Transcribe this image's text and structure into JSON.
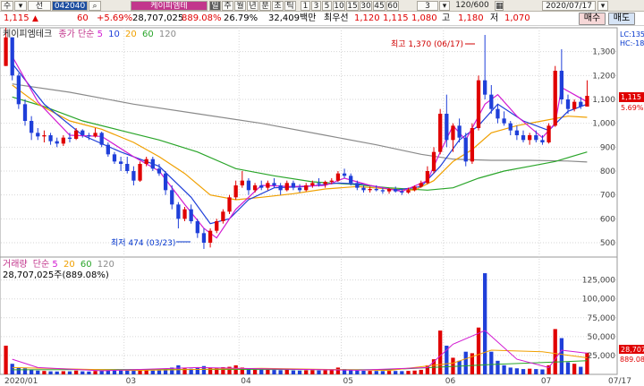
{
  "toolbar": {
    "cells": [
      "수",
      "선",
      "042040",
      "케이피엠테",
      "일",
      "주",
      "월",
      "년",
      "분",
      "초",
      "틱",
      "1",
      "3",
      "5",
      "10",
      "15",
      "30",
      "45",
      "60",
      "3",
      "120/600",
      "2020/07/17"
    ]
  },
  "info": {
    "price": "1,115",
    "arrow": "▲",
    "change": "60",
    "change_pct": "+5.69%",
    "volume": "28,707,025",
    "volume_ratio": "889.08%",
    "turnover": "26.79%",
    "amount": "32,409백만",
    "best_ask_label": "최우선",
    "best_ask": "1,120",
    "best_bid": "1,115",
    "low_val": "1,080",
    "high_label": "고",
    "high_val": "1,180",
    "low_label": "저",
    "low2_val": "1,070",
    "buy_label": "매수",
    "sell_label": "매도"
  },
  "price_legend": {
    "name": "케이피엠테크",
    "ma_label": "종가 단순",
    "ma_periods": [
      "5",
      "10",
      "20",
      "60",
      "120"
    ],
    "ma_colors": [
      "#d21bd2",
      "#1f3fd9",
      "#f0a000",
      "#2aa52a",
      "#8a8a8a"
    ]
  },
  "vol_legend": {
    "name": "거래량",
    "ma_label": "단순",
    "ma_periods": [
      "5",
      "20",
      "60",
      "120"
    ],
    "ma_colors": [
      "#d21bd2",
      "#f0a000",
      "#2aa52a",
      "#8a8a8a"
    ],
    "summary": "28,707,025주(889.08%)"
  },
  "price_axis": {
    "ticks": [
      "1,300",
      "1,200",
      "1,100",
      "1,000",
      "900",
      "800",
      "700",
      "600",
      "500"
    ],
    "current_label": "1,115",
    "pct_label": "5.69%",
    "lc_label": "LC:135",
    "hc_label": "HC:-18"
  },
  "volume_axis": {
    "ticks": [
      "125,000",
      "100,000",
      "75,000",
      "50,000",
      "25,000"
    ],
    "current_label": "28,707",
    "pct_label": "889.08"
  },
  "x_axis": {
    "ticks": [
      "2020/01",
      "03",
      "04",
      "05",
      "06",
      "07",
      "07/17"
    ]
  },
  "annotations": {
    "high": "최고 1,370 (06/17)",
    "low": "최저 474 (03/23)"
  },
  "colors": {
    "up": "#e00000",
    "down": "#1f3fd9",
    "ma5": "#d21bd2",
    "ma10": "#1f3fd9",
    "ma20": "#f0a000",
    "ma60": "#2aa52a",
    "ma120": "#8a8a8a"
  },
  "chart_data": {
    "type": "candlestick",
    "x_start": "2020/01",
    "x_end": "07/17",
    "ylim": [
      440,
      1400
    ],
    "volume_ylim": [
      0,
      140000
    ],
    "candles": [
      [
        1240,
        1400,
        1240,
        1360
      ],
      [
        1360,
        1360,
        1180,
        1200
      ],
      [
        1200,
        1210,
        1060,
        1080
      ],
      [
        1080,
        1100,
        990,
        1010
      ],
      [
        1010,
        1030,
        930,
        960
      ],
      [
        960,
        980,
        930,
        945
      ],
      [
        945,
        970,
        920,
        950
      ],
      [
        950,
        960,
        910,
        925
      ],
      [
        925,
        940,
        900,
        915
      ],
      [
        915,
        950,
        905,
        940
      ],
      [
        940,
        960,
        920,
        935
      ],
      [
        935,
        980,
        930,
        970
      ],
      [
        970,
        975,
        940,
        950
      ],
      [
        950,
        960,
        930,
        945
      ],
      [
        945,
        980,
        940,
        960
      ],
      [
        960,
        965,
        900,
        910
      ],
      [
        910,
        920,
        860,
        870
      ],
      [
        870,
        880,
        830,
        840
      ],
      [
        840,
        860,
        800,
        830
      ],
      [
        830,
        860,
        790,
        800
      ],
      [
        800,
        820,
        740,
        760
      ],
      [
        760,
        840,
        755,
        830
      ],
      [
        830,
        860,
        820,
        850
      ],
      [
        850,
        860,
        800,
        810
      ],
      [
        810,
        830,
        780,
        790
      ],
      [
        790,
        800,
        700,
        720
      ],
      [
        720,
        740,
        640,
        660
      ],
      [
        660,
        670,
        560,
        600
      ],
      [
        600,
        650,
        590,
        640
      ],
      [
        640,
        660,
        580,
        590
      ],
      [
        590,
        600,
        520,
        540
      ],
      [
        540,
        560,
        474,
        500
      ],
      [
        500,
        560,
        480,
        550
      ],
      [
        550,
        600,
        540,
        590
      ],
      [
        590,
        640,
        580,
        630
      ],
      [
        630,
        700,
        620,
        690
      ],
      [
        690,
        760,
        680,
        740
      ],
      [
        740,
        800,
        730,
        760
      ],
      [
        760,
        770,
        700,
        720
      ],
      [
        720,
        750,
        710,
        740
      ],
      [
        740,
        760,
        720,
        730
      ],
      [
        730,
        760,
        720,
        750
      ],
      [
        750,
        770,
        730,
        740
      ],
      [
        740,
        750,
        700,
        720
      ],
      [
        720,
        760,
        715,
        750
      ],
      [
        750,
        760,
        720,
        730
      ],
      [
        730,
        745,
        710,
        720
      ],
      [
        720,
        750,
        715,
        740
      ],
      [
        740,
        760,
        730,
        750
      ],
      [
        750,
        770,
        735,
        745
      ],
      [
        745,
        760,
        730,
        755
      ],
      [
        755,
        770,
        745,
        760
      ],
      [
        760,
        800,
        755,
        790
      ],
      [
        790,
        810,
        770,
        780
      ],
      [
        780,
        790,
        740,
        750
      ],
      [
        750,
        760,
        720,
        730
      ],
      [
        730,
        740,
        710,
        720
      ],
      [
        720,
        735,
        710,
        725
      ],
      [
        725,
        740,
        715,
        720
      ],
      [
        720,
        730,
        705,
        715
      ],
      [
        715,
        730,
        705,
        725
      ],
      [
        725,
        735,
        710,
        715
      ],
      [
        715,
        725,
        700,
        710
      ],
      [
        710,
        730,
        705,
        720
      ],
      [
        720,
        740,
        715,
        735
      ],
      [
        735,
        760,
        730,
        750
      ],
      [
        750,
        820,
        745,
        800
      ],
      [
        800,
        900,
        790,
        880
      ],
      [
        880,
        1060,
        870,
        1040
      ],
      [
        1040,
        1120,
        900,
        930
      ],
      [
        930,
        1000,
        880,
        990
      ],
      [
        990,
        1020,
        920,
        940
      ],
      [
        940,
        960,
        820,
        840
      ],
      [
        840,
        1000,
        830,
        980
      ],
      [
        980,
        1200,
        970,
        1180
      ],
      [
        1180,
        1370,
        1100,
        1120
      ],
      [
        1120,
        1160,
        1040,
        1060
      ],
      [
        1060,
        1080,
        1000,
        1020
      ],
      [
        1020,
        1050,
        990,
        1000
      ],
      [
        1000,
        1010,
        950,
        970
      ],
      [
        970,
        990,
        930,
        950
      ],
      [
        950,
        970,
        920,
        930
      ],
      [
        930,
        960,
        910,
        950
      ],
      [
        950,
        970,
        920,
        930
      ],
      [
        930,
        950,
        910,
        920
      ],
      [
        920,
        1000,
        915,
        990
      ],
      [
        990,
        1240,
        985,
        1220
      ],
      [
        1220,
        1310,
        1080,
        1100
      ],
      [
        1100,
        1120,
        1040,
        1060
      ],
      [
        1060,
        1100,
        1050,
        1090
      ],
      [
        1090,
        1110,
        1060,
        1070
      ],
      [
        1070,
        1180,
        1070,
        1115
      ]
    ],
    "volumes": [
      38000,
      14000,
      9000,
      8000,
      6000,
      5000,
      4500,
      4000,
      3800,
      4200,
      4000,
      5000,
      4000,
      3800,
      4500,
      5500,
      5000,
      4800,
      5200,
      5000,
      6000,
      7000,
      6500,
      5000,
      5200,
      7000,
      9000,
      12000,
      8000,
      7500,
      9000,
      11000,
      9000,
      8500,
      9500,
      10000,
      12000,
      9000,
      7000,
      6500,
      6000,
      6200,
      5800,
      5500,
      6000,
      5200,
      5000,
      5400,
      5600,
      5200,
      5500,
      5800,
      9000,
      7000,
      6000,
      5000,
      4800,
      4600,
      4500,
      4400,
      4600,
      4500,
      4300,
      4600,
      5000,
      6000,
      12000,
      20000,
      58000,
      38000,
      22000,
      18000,
      30000,
      28000,
      62000,
      134000,
      30000,
      18000,
      12000,
      9000,
      8000,
      7000,
      7500,
      7000,
      6500,
      12000,
      60000,
      48000,
      16000,
      14000,
      10000,
      28707
    ],
    "ma_lines": {
      "ma5": [
        [
          1,
          1280
        ],
        [
          5,
          1090
        ],
        [
          10,
          950
        ],
        [
          15,
          945
        ],
        [
          20,
          860
        ],
        [
          24,
          800
        ],
        [
          28,
          660
        ],
        [
          31,
          560
        ],
        [
          33,
          520
        ],
        [
          36,
          640
        ],
        [
          40,
          740
        ],
        [
          45,
          735
        ],
        [
          50,
          740
        ],
        [
          53,
          770
        ],
        [
          57,
          740
        ],
        [
          62,
          715
        ],
        [
          66,
          760
        ],
        [
          68,
          880
        ],
        [
          70,
          990
        ],
        [
          72,
          930
        ],
        [
          75,
          1080
        ],
        [
          77,
          1120
        ],
        [
          80,
          1030
        ],
        [
          84,
          940
        ],
        [
          86,
          1000
        ],
        [
          87,
          1150
        ],
        [
          89,
          1120
        ],
        [
          91,
          1090
        ]
      ],
      "ma10": [
        [
          1,
          1250
        ],
        [
          6,
          1080
        ],
        [
          12,
          950
        ],
        [
          18,
          880
        ],
        [
          24,
          820
        ],
        [
          29,
          690
        ],
        [
          32,
          580
        ],
        [
          35,
          600
        ],
        [
          38,
          680
        ],
        [
          42,
          730
        ],
        [
          47,
          735
        ],
        [
          52,
          750
        ],
        [
          56,
          745
        ],
        [
          61,
          720
        ],
        [
          65,
          735
        ],
        [
          68,
          820
        ],
        [
          71,
          930
        ],
        [
          74,
          990
        ],
        [
          77,
          1080
        ],
        [
          81,
          1010
        ],
        [
          85,
          970
        ],
        [
          88,
          1050
        ],
        [
          91,
          1080
        ]
      ],
      "ma20": [
        [
          1,
          1160
        ],
        [
          5,
          1080
        ],
        [
          10,
          1010
        ],
        [
          15,
          975
        ],
        [
          20,
          920
        ],
        [
          24,
          860
        ],
        [
          28,
          790
        ],
        [
          32,
          700
        ],
        [
          36,
          680
        ],
        [
          40,
          690
        ],
        [
          45,
          705
        ],
        [
          50,
          725
        ],
        [
          55,
          735
        ],
        [
          60,
          725
        ],
        [
          64,
          720
        ],
        [
          67,
          760
        ],
        [
          70,
          840
        ],
        [
          73,
          890
        ],
        [
          76,
          960
        ],
        [
          80,
          990
        ],
        [
          84,
          1010
        ],
        [
          88,
          1030
        ],
        [
          91,
          1025
        ]
      ],
      "ma60": [
        [
          1,
          1110
        ],
        [
          6,
          1070
        ],
        [
          12,
          1010
        ],
        [
          18,
          970
        ],
        [
          24,
          930
        ],
        [
          30,
          880
        ],
        [
          36,
          810
        ],
        [
          42,
          780
        ],
        [
          48,
          755
        ],
        [
          54,
          745
        ],
        [
          60,
          730
        ],
        [
          66,
          720
        ],
        [
          70,
          730
        ],
        [
          74,
          770
        ],
        [
          78,
          800
        ],
        [
          82,
          820
        ],
        [
          86,
          840
        ],
        [
          91,
          880
        ]
      ],
      "ma120": [
        [
          1,
          1165
        ],
        [
          10,
          1130
        ],
        [
          20,
          1080
        ],
        [
          30,
          1040
        ],
        [
          40,
          1000
        ],
        [
          50,
          950
        ],
        [
          58,
          910
        ],
        [
          65,
          870
        ],
        [
          70,
          850
        ],
        [
          76,
          845
        ],
        [
          82,
          845
        ],
        [
          88,
          842
        ],
        [
          91,
          838
        ]
      ]
    },
    "vol_ma_lines": {
      "ma5": [
        [
          1,
          20000
        ],
        [
          5,
          9000
        ],
        [
          15,
          4800
        ],
        [
          30,
          9000
        ],
        [
          40,
          7500
        ],
        [
          55,
          5500
        ],
        [
          66,
          9000
        ],
        [
          70,
          40000
        ],
        [
          75,
          58000
        ],
        [
          80,
          20000
        ],
        [
          85,
          9000
        ],
        [
          87,
          32000
        ],
        [
          91,
          28000
        ]
      ],
      "ma20": [
        [
          1,
          9000
        ],
        [
          20,
          5200
        ],
        [
          40,
          8000
        ],
        [
          60,
          5200
        ],
        [
          70,
          15000
        ],
        [
          76,
          32000
        ],
        [
          84,
          30000
        ],
        [
          91,
          22000
        ]
      ],
      "ma60": [
        [
          1,
          6000
        ],
        [
          30,
          6500
        ],
        [
          60,
          6200
        ],
        [
          76,
          13000
        ],
        [
          91,
          18000
        ]
      ]
    }
  }
}
